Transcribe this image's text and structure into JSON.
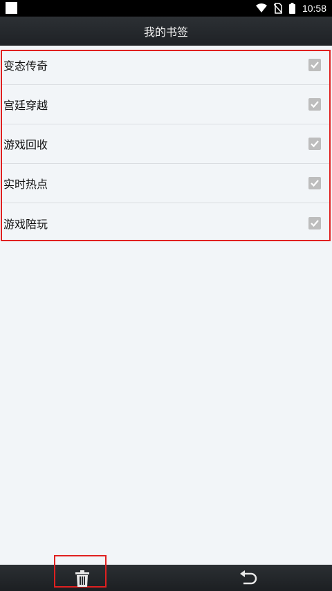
{
  "status_bar": {
    "time": "10:58"
  },
  "header": {
    "title": "我的书签"
  },
  "bookmarks": [
    {
      "label": "变态传奇",
      "checked": true
    },
    {
      "label": "宫廷穿越",
      "checked": true
    },
    {
      "label": "游戏回收",
      "checked": true
    },
    {
      "label": "实时热点",
      "checked": true
    },
    {
      "label": "游戏陪玩",
      "checked": true
    }
  ],
  "colors": {
    "highlight": "#e02020",
    "bar_dark": "#1f2226",
    "list_bg": "#f2f5f8"
  },
  "icons": {
    "delete": "trash-icon",
    "back": "undo-arrow-icon"
  }
}
